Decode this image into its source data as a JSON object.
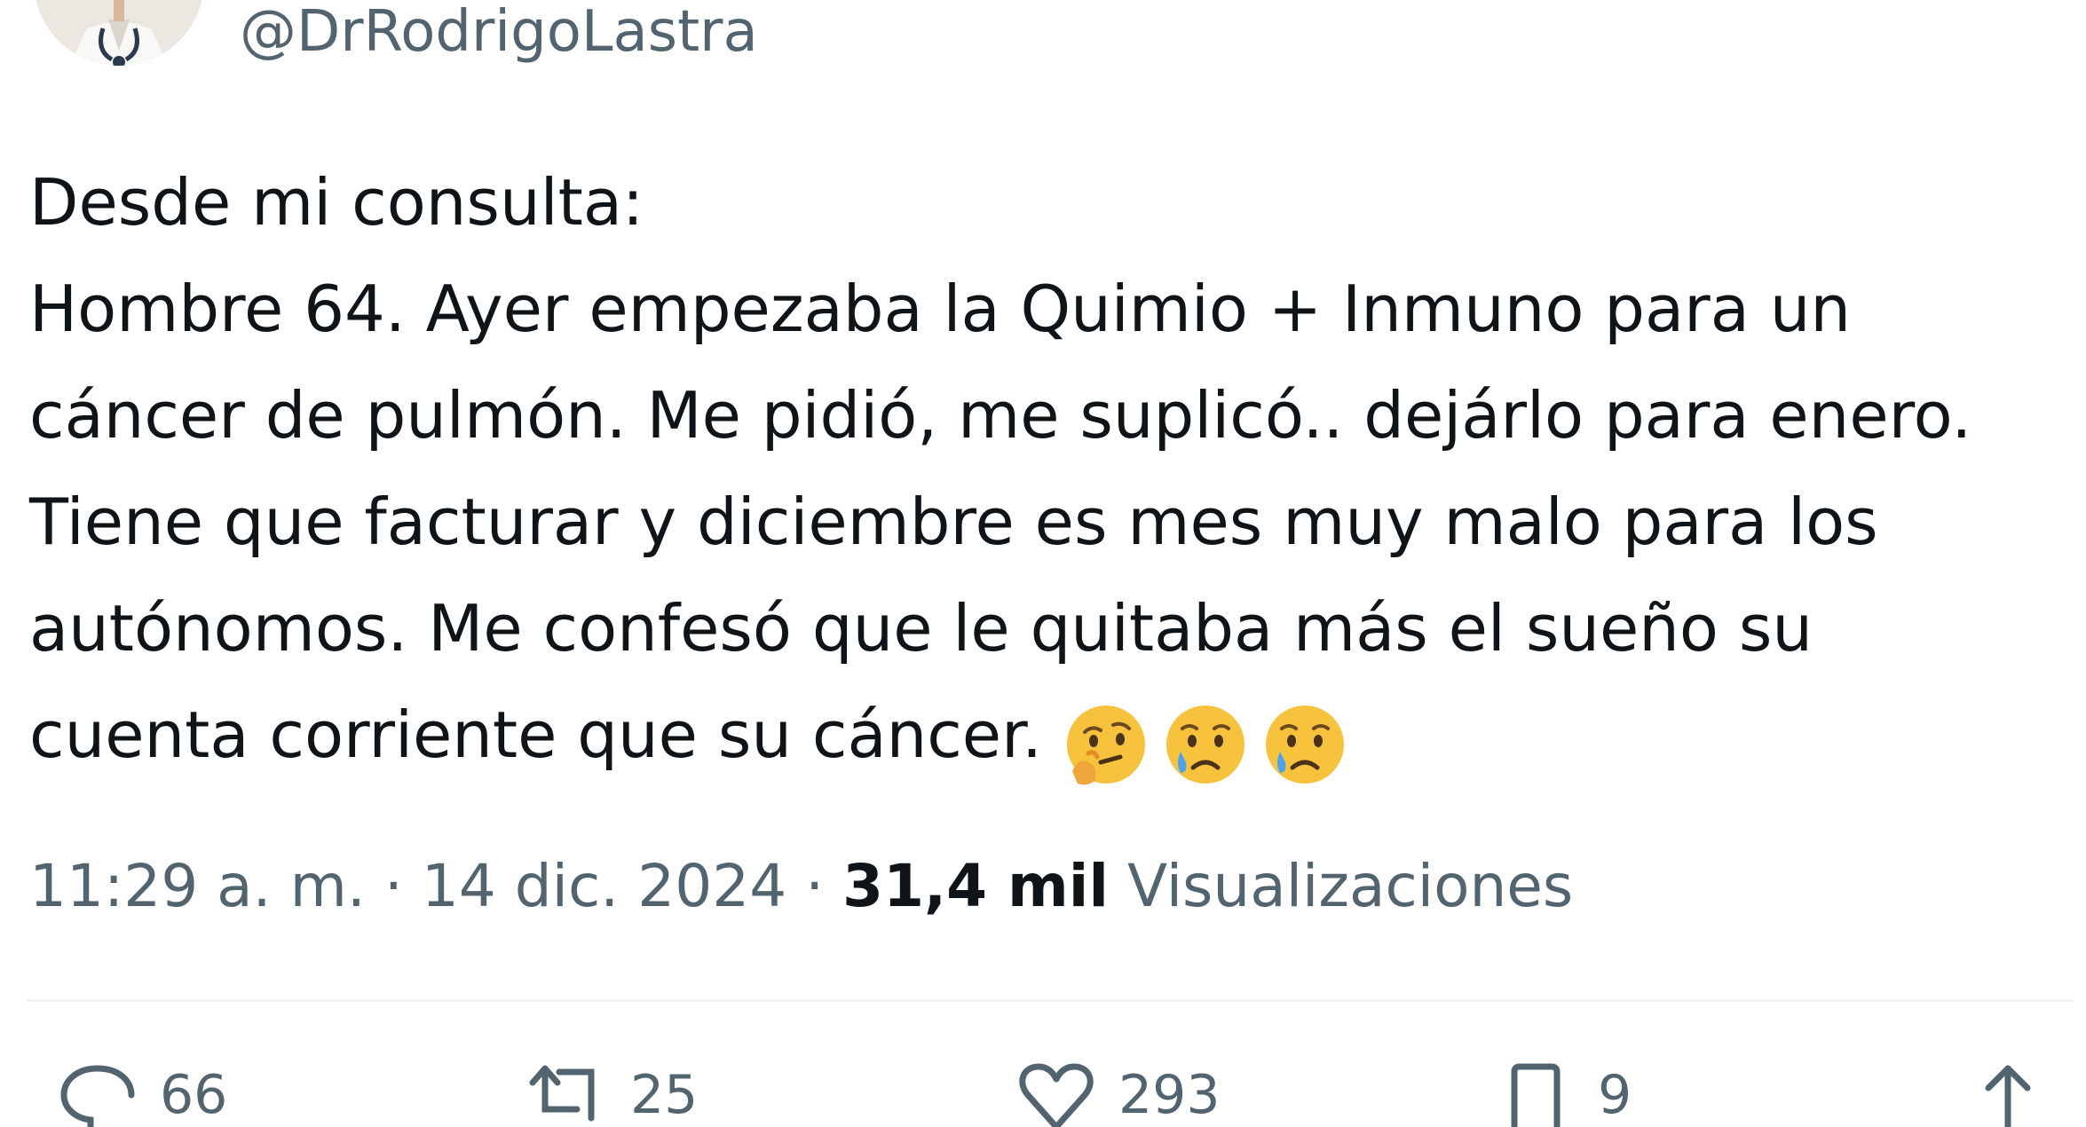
{
  "author": {
    "handle": "@DrRodrigoLastra"
  },
  "tweet": {
    "lines": [
      "Desde mi consulta:",
      "Hombre 64. Ayer empezaba la Quimio + Inmuno para un",
      "cáncer de pulmón. Me pidió, me suplicó.. dejárlo para enero.",
      "Tiene que facturar y diciembre es mes muy malo para los",
      "autónomos. Me confesó que le quitaba más el sueño su",
      "cuenta corriente que su cáncer."
    ],
    "emojis": [
      "thinking-face",
      "crying-face",
      "crying-face"
    ]
  },
  "meta": {
    "time": "11:29 a. m.",
    "separator": "·",
    "date": "14 dic. 2024",
    "views_count": "31,4 mil",
    "views_label": "Visualizaciones"
  },
  "actions": {
    "reply_count": "66",
    "retweet_count": "25",
    "like_count": "293",
    "bookmark_count": "9"
  },
  "colors": {
    "text": "#0f1419",
    "secondary": "#536471",
    "divider": "#eff3f4"
  }
}
